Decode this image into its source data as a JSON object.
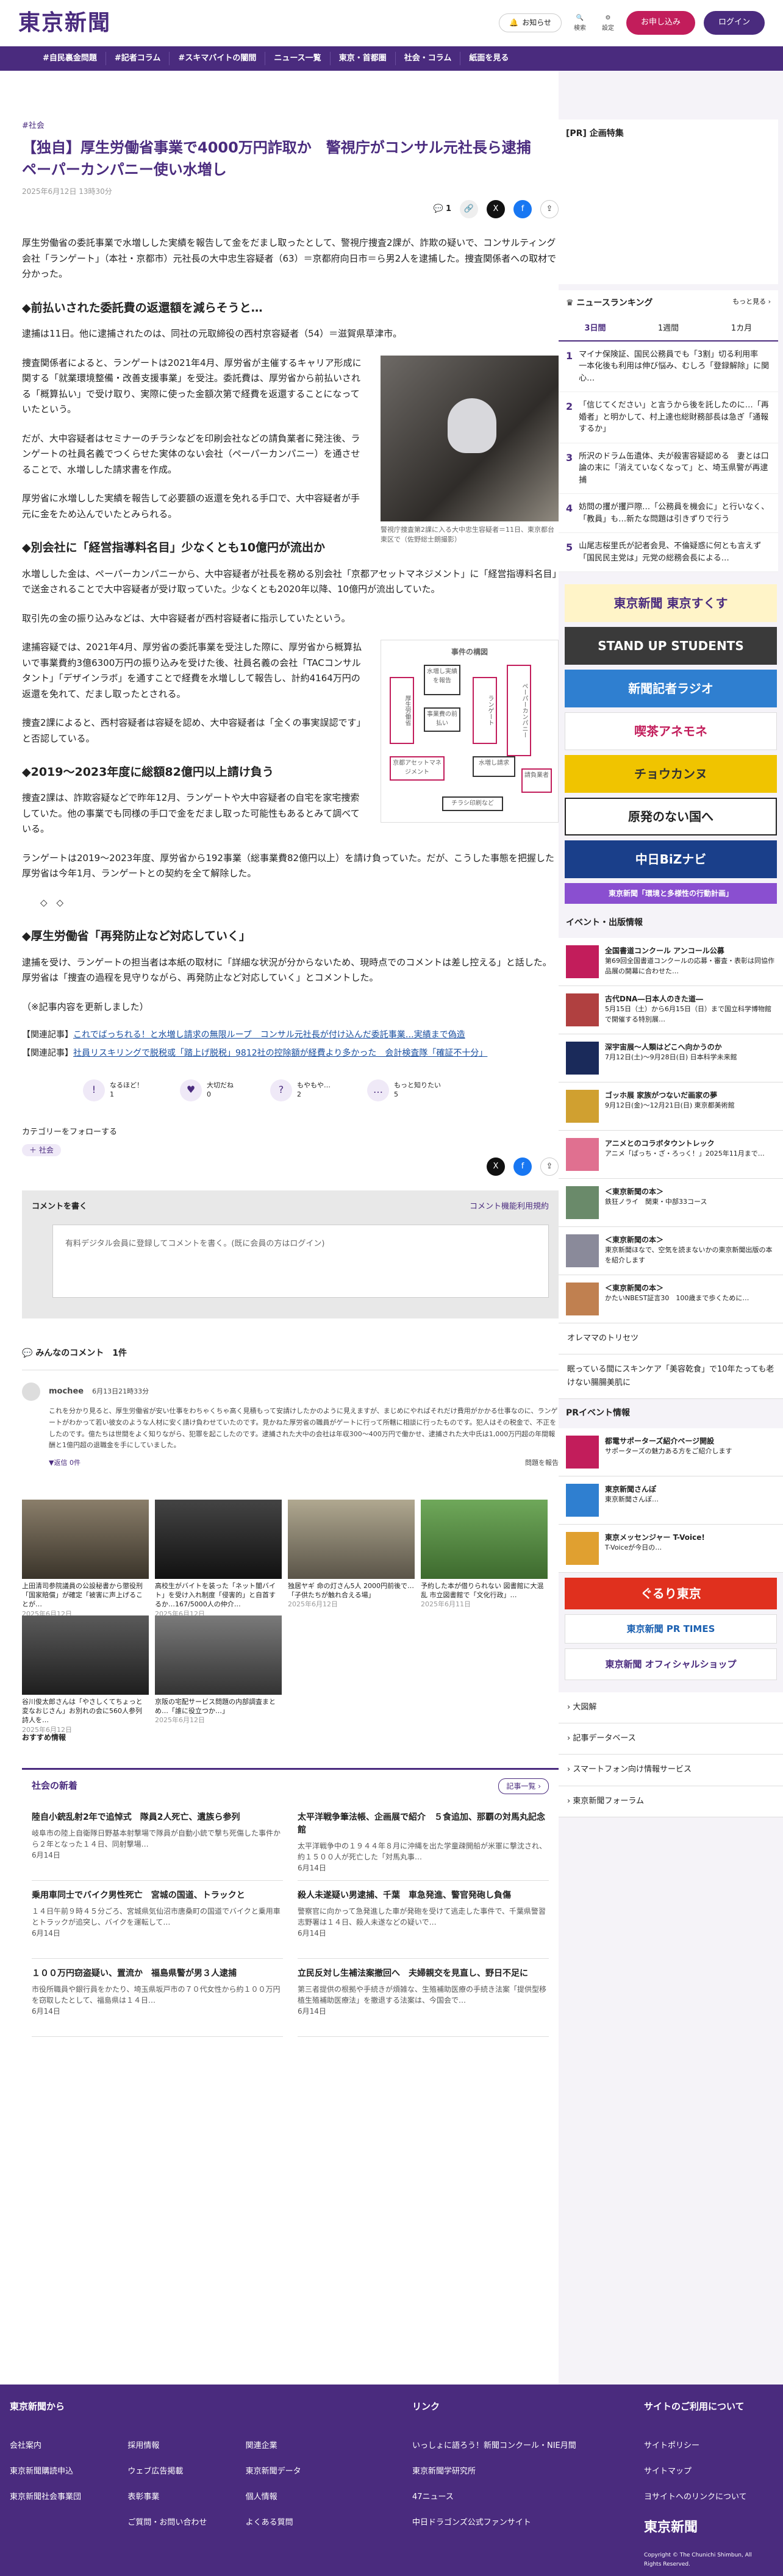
{
  "header": {
    "logo": "東京新聞",
    "notice": "お知らせ",
    "search": "検索",
    "settings": "設定",
    "signup": "お申し込み",
    "login": "ログイン"
  },
  "nav": [
    "#自民裏金問題",
    "#記者コラム",
    "#スキマバイトの闇間",
    "ニュース一覧",
    "東京・首都圏",
    "社会・コラム",
    "紙面を見る"
  ],
  "article": {
    "category": "#社会",
    "title": "【独自】厚生労働省事業で4000万円詐取か　警視庁がコンサル元社長ら逮捕　ペーパーカンパニー使い水増し",
    "date": "2025年6月12日 13時30分",
    "comment_count": "1",
    "lead": "厚生労働省の委託事業で水増しした実績を報告して金をだまし取ったとして、警視庁捜査2課が、詐欺の疑いで、コンサルティング会社「ランゲート」（本社・京都市）元社長の大中忠生容疑者（63）＝京都府向日市＝ら男2人を逮捕した。捜査関係者への取材で分かった。",
    "h_a": "◆前払いされた委託費の返還額を減らそうと…",
    "p_a1": "逮捕は11日。他に逮捕されたのは、同社の元取締役の西村京容疑者（54）＝滋賀県草津市。",
    "p_a2": "捜査関係者によると、ランゲートは2021年4月、厚労省が主催するキャリア形成に関する「就業環境整備・改善支援事業」を受注。委託費は、厚労省から前払いされる「概算払い」で受け取り、実際に使った金額次第で経費を返還することになっていたという。",
    "p_a3": "だが、大中容疑者はセミナーのチラシなどを印刷会社などの請負業者に発注後、ランゲートの社員名義でつくらせた実体のない会社（ペーパーカンパニー）を通させることで、水増しした請求書を作成。",
    "p_a4": "厚労省に水増しした実績を報告して必要額の返還を免れる手口で、大中容疑者が手元に金をため込んでいたとみられる。",
    "photo_caption": "警視庁捜査第2課に入る大中忠生容疑者＝11日、東京都台東区で（佐野総士朗撮影）",
    "h_b": "◆別会社に「経営指導料名目」少なくとも10億円が流出か",
    "p_b1": "水増しした金は、ペーパーカンパニーから、大中容疑者が社長を務める別会社「京都アセットマネジメント」に「経営指導料名目」で送金されることで大中容疑者が受け取っていた。少なくとも2020年以降、10億円が流出していた。",
    "p_b2": "取引先の金の振り込みなどは、大中容疑者が西村容疑者に指示していたという。",
    "p_b3": "逮捕容疑では、2021年4月、厚労省の委託事業を受注した際に、厚労省から概算払いで事業費約3億6300万円の振り込みを受けた後、社員名義の会社「TACコンサルタント」「デザインラボ」を通すことで経費を水増しして報告し、計約4164万円の返還を免れて、だまし取ったとされる。",
    "p_b4": "捜査2課によると、西村容疑者は容疑を認め、大中容疑者は「全くの事実誤認です」と否認している。",
    "diagram": {
      "title": "事件の構図",
      "l1": "厚生労働省",
      "l2": "水増し実績を報告",
      "l3": "事業費の前払い",
      "l4": "ランゲート",
      "l5": "ペーパーカンパニー",
      "l6": "水増し請求",
      "l7": "請負業者",
      "l8": "京都アセットマネジメント",
      "l9": "チラシ印刷など"
    },
    "h_c": "◆2019〜2023年度に総額82億円以上請け負う",
    "p_c1": "捜査2課は、詐欺容疑などで昨年12月、ランゲートや大中容疑者の自宅を家宅捜索していた。他の事業でも同様の手口で金をだまし取った可能性もあるとみて調べている。",
    "p_c2": "ランゲートは2019〜2023年度、厚労省から192事業（総事業費82億円以上）を請け負っていた。だが、こうした事態を把握した厚労省は今年1月、ランゲートとの契約を全て解除した。",
    "ornament": "◇　◇",
    "h_d": "◆厚生労働省「再発防止など対応していく」",
    "p_d1": "逮捕を受け、ランゲートの担当者は本紙の取材に「詳細な状況が分からないため、現時点でのコメントは差し控える」と話した。厚労省は「捜査の過程を見守りながら、再発防止など対応していく」とコメントした。",
    "p_d2": "（※記事内容を更新しました）",
    "rel1_tag": "【関連記事】",
    "rel1": "これでばっちれる！と水増し請求の無限ループ　コンサル元社長が付け込んだ委託事業…実績まで偽造",
    "rel2_tag": "【関連記事】",
    "rel2": "社員リスキリングで脱税或「踏上げ脱税」9812社の控除額が経費より多かった　会計検査隊「確証不十分」"
  },
  "reactions": [
    {
      "icon": "!",
      "label": "なるほど！",
      "count": "1"
    },
    {
      "icon": "♥",
      "label": "大切だね",
      "count": "0"
    },
    {
      "icon": "?",
      "label": "もやもや…",
      "count": "2"
    },
    {
      "icon": "…",
      "label": "もっと知りたい",
      "count": "5"
    }
  ],
  "follow": {
    "label": "カテゴリーをフォローする",
    "tag": "社会"
  },
  "comment_box": {
    "title": "コメントを書く",
    "policy": "コメント機能利用規約",
    "placeholder": "有料デジタル会員に登録してコメントを書く。(既に会員の方はログイン)"
  },
  "comments": {
    "title": "みんなのコメント",
    "count": "1件",
    "user": "mochee",
    "date": "6月13日21時33分",
    "text": "これを分かり見ると、厚生労働省が安い仕事をわちゃくちゃ高く見積もって安請けしたかのように見えますが、まじめにやればそれだけ費用がかかる仕事なのに、ランゲートがわかって若い彼女のような人材に安く請け負わせていたのです。見かねた厚労省の職員がゲートに行って所轄に相談に行ったものです。犯人はその税金で、不正をしたのです。億たちは世間をよく知りながら、犯罪を起こしたのです。逮捕された大中の会社は年収300〜400万円で働かせ、逮捕された大中氏は1,000万円超の年間報酬と1億円超の退職金を手にしていました。",
    "reply": "▼返信 0件",
    "report": "問題を報告"
  },
  "related_grid": [
    {
      "caption": "上田清司参院議員の公設秘書から懲役刑「国家賠償」が確定「被害に声上げることが…",
      "date": "2025年6月12日"
    },
    {
      "caption": "高校生がバイトを装った「ネット闇バイト」を受け入れ制度「侵害的」と自首するか…167/5000人の仲介…",
      "date": "2025年6月12日"
    },
    {
      "caption": "独居ヤギ 命の灯さん5人 2000円前後で…「子供たちが触れ合える場」",
      "date": "2025年6月12日"
    },
    {
      "caption": "予約した本が借りられない 図書館に大混乱 市立図書館で「文化行政」…",
      "date": "2025年6月11日"
    },
    {
      "caption": "谷川俊太郎さんは「やさしくてちょっと変なおじさん」お別れの会に560人参列　詩人を…",
      "date": "2025年6月12日"
    },
    {
      "caption": "京阪の宅配サービス問題の内部調査まとめ…「誰に役立つか…」",
      "date": "2025年6月12日"
    }
  ],
  "recommend": "おすすめ情報",
  "latest": {
    "title": "社会の新着",
    "more": "記事一覧 ›",
    "items": [
      {
        "title": "陸自小銃乱射2年で追悼式　隊員2人死亡、遺族ら参列",
        "text": "岐阜市の陸上自衛隊日野基本射撃場で隊員が自動小銃で撃ち死傷した事件から２年となった１４日、同射撃場…",
        "date": "6月14日"
      },
      {
        "title": "太平洋戦争筆法帳、企画展で紹介　５食追加、那覇の対馬丸記念館",
        "text": "太平洋戦争中の１９４４年８月に沖縄を出た学童疎開船が米軍に撃沈され、約１５００人が死亡した「対馬丸事…",
        "date": "6月14日"
      },
      {
        "title": "乗用車同士でバイク男性死亡　宮城の国道、トラックと",
        "text": "１４日午前９時４５分ごろ、宮城県気仙沼市唐桑町の国道でバイクと乗用車とトラックが追突し、バイクを運転して…",
        "date": "6月14日"
      },
      {
        "title": "殺人未遂疑い男逮捕、千葉　車急発進、警官発砲し負傷",
        "text": "警察官に向かって急発進した車が発砲を受けて逃走した事件で、千葉県警習志野署は１４日、殺人未遂などの疑いで…",
        "date": "6月14日"
      },
      {
        "title": "１００万円窃盗疑い、置流か　福島県警が男３人逮捕",
        "text": "市役所職員や銀行員をかたり、埼玉県坂戸市の７０代女性から約１００万円を窃取したとして、福島県は１４日…",
        "date": "6月14日"
      },
      {
        "title": "立民反対し生補法案撤回へ　夫婦親交を見直し、野日不足に",
        "text": "第三者提供の根拠や手続きが煩雑な、生殖補助医療の手続き法案「提供型移植生殖補助医療法」を撤退する法案は、今国会で…",
        "date": "6月14日"
      }
    ]
  },
  "side": {
    "pr_title": "[PR] 企画特集",
    "ranking_title": "ニュースランキング",
    "ranking_more": "もっと見る ›",
    "tabs": [
      "3日間",
      "1週間",
      "1カ月"
    ],
    "ranks": [
      "マイナ保険証、国民公務員でも「3割」切る利用率　一本化後も利用は伸び悩み、むしろ「登録解除」に関心…",
      "「信じてください」と言うから後を託したのに…「再婚者」と明かして、村上達也総財務部長は急ぎ「通報するか」",
      "所沢のドラム缶遺体、夫が殺害容疑認める　妻とは口論の末に「消えていなくなって」と、埼玉県警が再逮捕",
      "妨問の攫が攫戸際…「公務員を機会に」と行いなく、「教員」も…新たな問題は引きずりで行う",
      "山尾志桜里氏が記者会見、不倫疑惑に何とも言えず「国民民主党は」元党の総務会長による…"
    ],
    "banners": [
      "東京新聞 東京すくす",
      "STAND UP STUDENTS",
      "新聞記者ラジオ",
      "喫茶アネモネ",
      "チョウカンヌ",
      "原発のない国へ",
      "中日BiZナビ",
      "東京新聞「環境と多様性の行動計画」"
    ],
    "events_title": "イベント・出版情報",
    "events": [
      {
        "t": "全国書道コンクール アンコール公募",
        "d": "第69回全国書道コンクールの応募・審査・表彰は同協作品展の開幕に合わせた…"
      },
      {
        "t": "古代DNA―日本人のきた道―",
        "d": "5月15日（土）から6月15日（日）まで国立科学博物館で開催する特別展…"
      },
      {
        "t": "深宇宙展〜人類はどこへ向かうのか",
        "d": "7月12日(土)〜9月28日(日) 日本科学未来館"
      },
      {
        "t": "ゴッホ展 家族がつないだ画家の夢",
        "d": "9月12日(金)〜12月21日(日) 東京都美術館"
      },
      {
        "t": "アニメとのコラボタウントレック",
        "d": "アニメ「ぱっち・ざ・ろっく！」2025年11月まで…"
      },
      {
        "t": "＜東京新聞の本＞",
        "d": "鉄狂ノライ　関東・中部33コース"
      },
      {
        "t": "＜東京新聞の本＞",
        "d": "東京新聞ほなで、空気を読まないかの東京新聞出版の本を紹介します"
      },
      {
        "t": "＜東京新聞の本＞",
        "d": "かたいNBEST証言30　100歳まで歩くために…"
      }
    ],
    "book_row": "オレママのトリセツ",
    "book_row2": "眠っている間にスキンケア「美容乾食」で10年たっても老けない腸腸美肌に",
    "pr_info": "PRイベント情報",
    "pr": [
      {
        "t": "都電サポーターズ紹介ページ開設",
        "d": "サポーターズの魅力ある方をご紹介します"
      },
      {
        "t": "東京新聞さんぽ",
        "d": "東京新聞さんぽ…"
      },
      {
        "t": "東京メッセンジャー T-Voice!",
        "d": "T-Voiceが今日の…"
      }
    ],
    "pr_banners": [
      "ぐるり東京",
      "東京新聞 PR TIMES",
      "東京新聞 オフィシャルショップ"
    ],
    "links": [
      "大図解",
      "記事データベース",
      "スマートフォン向け情報サービス",
      "東京新聞フォーラム"
    ]
  },
  "footer": {
    "cols": [
      {
        "h": "東京新聞から",
        "items": [
          "会社案内",
          "東京新聞購読申込",
          "東京新聞社会事業団",
          "採用情報",
          "ウェブ広告掲載",
          "表彰事業",
          "ご質問・お問い合わせ",
          "関連企業",
          "東京新聞データ",
          "個人情報",
          "よくある質問"
        ]
      },
      {
        "h": "リンク",
        "items": [
          "いっしょに語ろう！新聞コンクール・NIE月間",
          "東京新聞学研究所",
          "47ニュース",
          "中日ドラゴンズ公式ファンサイト"
        ]
      },
      {
        "h": "サイトのご利用について",
        "items": [
          "サイトポリシー",
          "サイトマップ",
          "ヨサイトへのリンクについて"
        ]
      }
    ],
    "copyright": "Copyright © The Chunichi Shimbun, All Rights Reserved."
  }
}
